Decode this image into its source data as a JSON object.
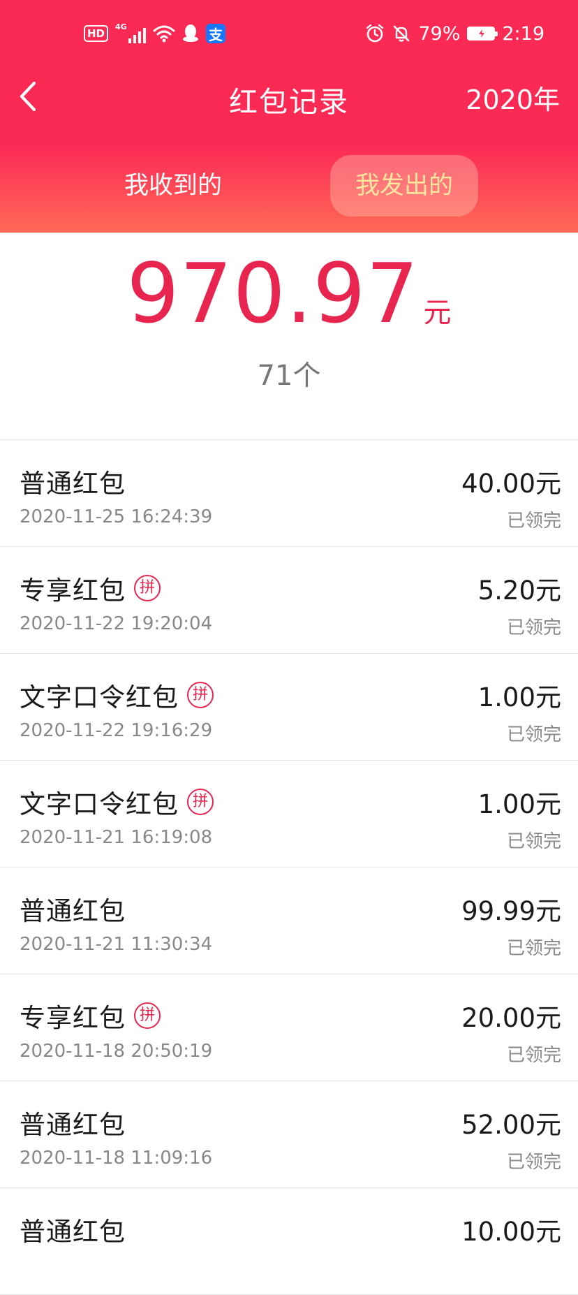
{
  "colors": {
    "header_red": "#fb2a55",
    "amount_red": "#e8254f",
    "active_tab_text": "#ffe69e",
    "secondary_text": "#888888"
  },
  "status_bar": {
    "left_icons": [
      "hd-icon",
      "4g-signal-icon",
      "wifi-icon",
      "qq-icon",
      "alipay-icon"
    ],
    "hd_label": "HD",
    "network_label": "4G",
    "alipay_glyph": "支",
    "battery_percent": "79%",
    "time": "2:19"
  },
  "nav": {
    "back_icon": "chevron-left-icon",
    "title": "红包记录",
    "year": "2020年"
  },
  "tabs": [
    {
      "label": "我收到的",
      "active": false
    },
    {
      "label": "我发出的",
      "active": true
    }
  ],
  "summary": {
    "total_amount": "970.97",
    "currency_unit": "元",
    "count": "71个"
  },
  "records": [
    {
      "type": "普通红包",
      "has_pin_badge": false,
      "time": "2020-11-25 16:24:39",
      "amount": "40.00元",
      "status": "已领完"
    },
    {
      "type": "专享红包",
      "has_pin_badge": true,
      "time": "2020-11-22 19:20:04",
      "amount": "5.20元",
      "status": "已领完"
    },
    {
      "type": "文字口令红包",
      "has_pin_badge": true,
      "time": "2020-11-22 19:16:29",
      "amount": "1.00元",
      "status": "已领完"
    },
    {
      "type": "文字口令红包",
      "has_pin_badge": true,
      "time": "2020-11-21 16:19:08",
      "amount": "1.00元",
      "status": "已领完"
    },
    {
      "type": "普通红包",
      "has_pin_badge": false,
      "time": "2020-11-21 11:30:34",
      "amount": "99.99元",
      "status": "已领完"
    },
    {
      "type": "专享红包",
      "has_pin_badge": true,
      "time": "2020-11-18 20:50:19",
      "amount": "20.00元",
      "status": "已领完"
    },
    {
      "type": "普通红包",
      "has_pin_badge": false,
      "time": "2020-11-18 11:09:16",
      "amount": "52.00元",
      "status": "已领完"
    },
    {
      "type": "普通红包",
      "has_pin_badge": false,
      "time": "",
      "amount": "10.00元",
      "status": ""
    }
  ],
  "pin_badge_label": "拼"
}
